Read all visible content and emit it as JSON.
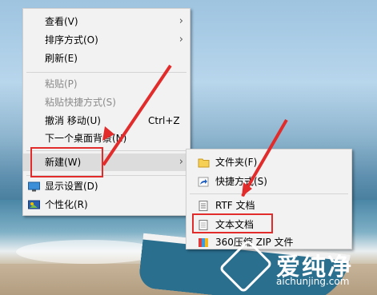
{
  "context_menu": {
    "items": [
      {
        "label": "查看(V)",
        "submenu": true
      },
      {
        "label": "排序方式(O)",
        "submenu": true
      },
      {
        "label": "刷新(E)"
      },
      {
        "label": "粘贴(P)",
        "disabled": true
      },
      {
        "label": "粘贴快捷方式(S)",
        "disabled": true
      },
      {
        "label": "撤消 移动(U)",
        "shortcut": "Ctrl+Z"
      },
      {
        "label": "下一个桌面背景(N)"
      },
      {
        "label": "新建(W)",
        "submenu": true,
        "highlighted": true
      },
      {
        "label": "显示设置(D)",
        "icon": "display-settings-icon"
      },
      {
        "label": "个性化(R)",
        "icon": "personalize-icon"
      }
    ]
  },
  "new_submenu": {
    "items": [
      {
        "label": "文件夹(F)",
        "icon": "folder-icon"
      },
      {
        "label": "快捷方式(S)",
        "icon": "shortcut-icon"
      },
      {
        "label": "RTF 文档",
        "icon": "rtf-document-icon"
      },
      {
        "label": "文本文档",
        "icon": "text-document-icon"
      },
      {
        "label": "360压缩 ZIP 文件",
        "icon": "zip-archive-icon"
      }
    ]
  },
  "watermark": {
    "title": "爱纯净",
    "url": "aichunjing.com"
  },
  "colors": {
    "annotation": "#e22b2b",
    "menu_bg": "#f2f2f2",
    "highlight": "#dcdcdc"
  }
}
